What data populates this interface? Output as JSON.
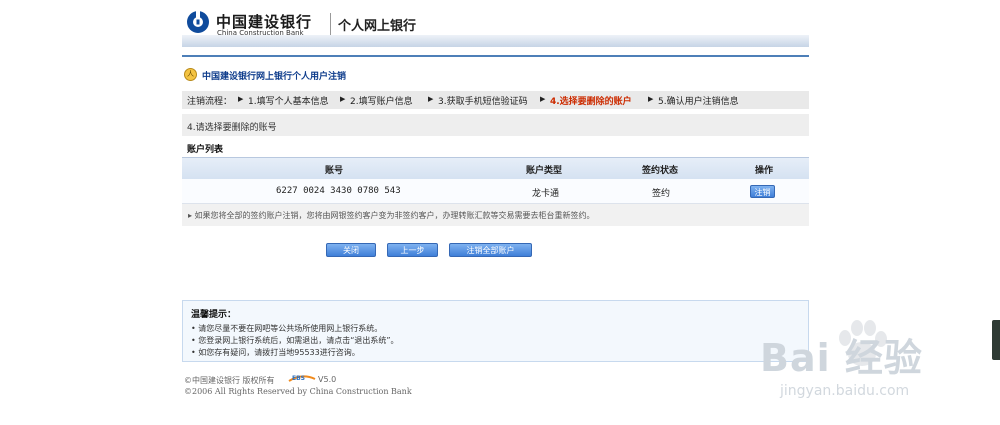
{
  "header": {
    "bank_name_cn": "中国建设银行",
    "bank_name_en": "China Construction Bank",
    "site_name": "个人网上银行",
    "brand_color": "#0f4b9c"
  },
  "page": {
    "title": "中国建设银行网上银行个人用户注销",
    "title_icon_glyph": "人"
  },
  "steps": {
    "prefix": "注销流程：",
    "items": [
      "1.填写个人基本信息",
      "2.填写账户信息",
      "3.获取手机短信验证码",
      "4.选择要删除的账户",
      "5.确认用户注销信息"
    ],
    "current_index": 3,
    "separator_icon": "triangle-right-icon"
  },
  "section": {
    "heading": "4.请选择要删除的账号",
    "list_title": "账户列表"
  },
  "table": {
    "columns": [
      "账号",
      "账户类型",
      "签约状态",
      "操作"
    ],
    "rows": [
      {
        "account": "6227 0024 3430 0780 543",
        "type": "龙卡通",
        "status": "签约",
        "action": "注销"
      }
    ],
    "note": "▸ 如果您将全部的签约账户注销，您将由网银签约客户变为非签约客户，办理转账汇款等交易需要去柜台重新签约。"
  },
  "actions": {
    "close": "关闭",
    "back": "上一步",
    "cancel_all": "注销全部账户"
  },
  "tips": {
    "title": "温馨提示：",
    "items": [
      "• 请您尽量不要在网吧等公共场所使用网上银行系统。",
      "• 您登录网上银行系统后，如需退出，请点击“退出系统”。",
      "• 如您存有疑问，请拨打当地95533进行咨询。"
    ]
  },
  "footer": {
    "copyright_cn": "©中国建设银行 版权所有",
    "version": "V5.0",
    "copyright_en": "©2006 All Rights Reserved by China Construction Bank"
  },
  "watermark": {
    "text": "Bai 经验",
    "url": "jingyan.baidu.com"
  }
}
